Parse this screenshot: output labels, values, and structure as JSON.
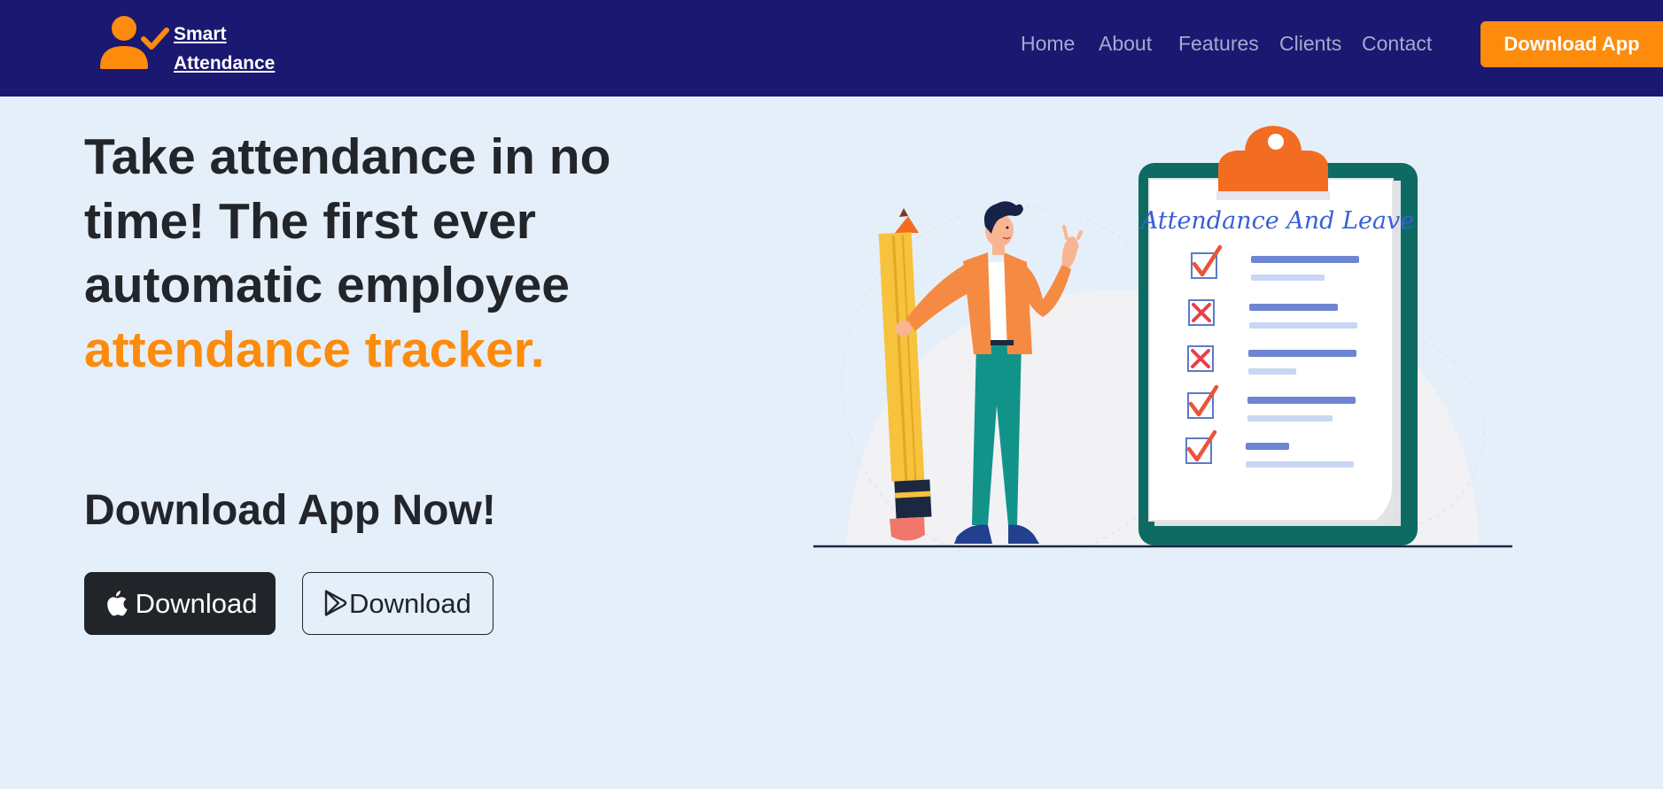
{
  "nav": {
    "brand_line1": "Smart",
    "brand_line2": "Attendance",
    "links": [
      "Home",
      "About",
      "Features",
      "Clients",
      "Contact"
    ],
    "cta_label": "Download App"
  },
  "hero": {
    "headline_main": "Take attendance in no time! The first ever automatic employee",
    "headline_accent": "attendance tracker.",
    "subhead": "Download App Now!",
    "apple_button_label": "Download",
    "play_button_label": "Download"
  },
  "illustration": {
    "clipboard_title": "Attendance And Leave",
    "checklist": [
      "check",
      "cross",
      "cross",
      "check",
      "check"
    ]
  },
  "colors": {
    "navbar_bg": "#1a1870",
    "accent": "#fd8b0c",
    "page_bg": "#e5eff9",
    "clipboard": "#0e6b63"
  },
  "icons": {
    "brand": "user-check-icon",
    "apple": "apple-icon",
    "play": "google-play-icon"
  }
}
